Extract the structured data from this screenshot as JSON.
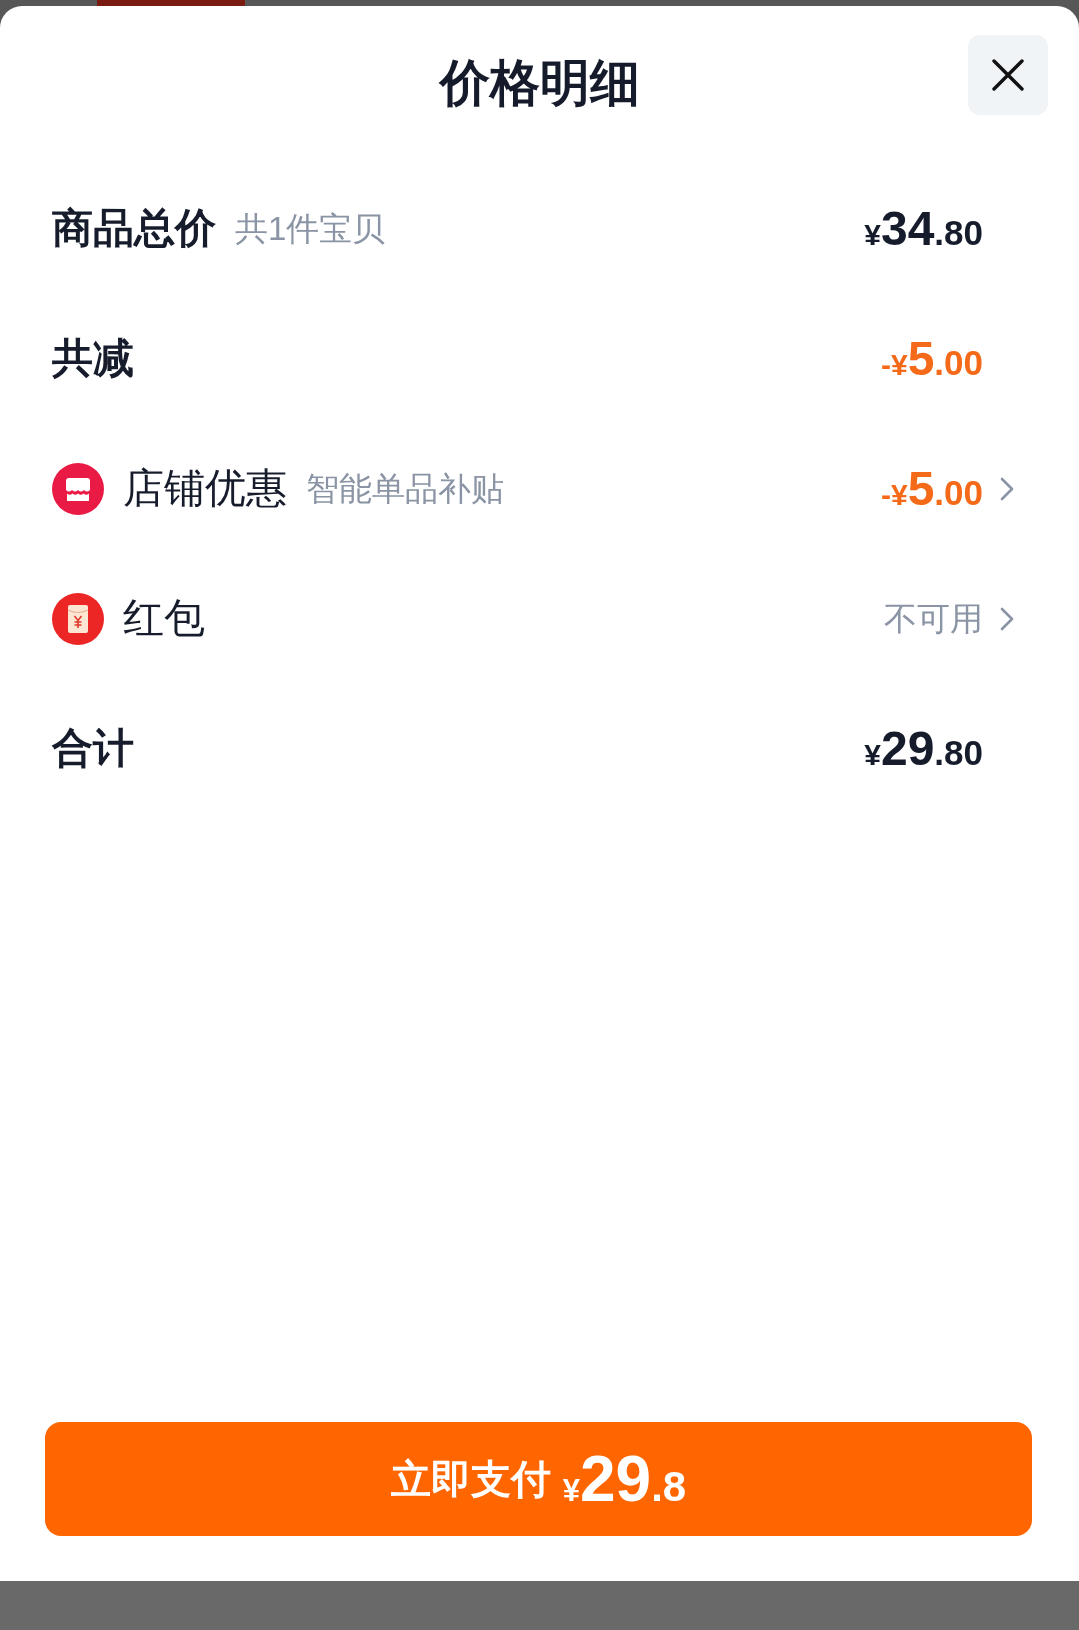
{
  "sheet": {
    "title": "价格明细"
  },
  "rows": [
    {
      "kind": "summary",
      "label": "商品总价",
      "note": "共1件宝贝",
      "value": {
        "kind": "price",
        "prefix": "¥",
        "integer": "34",
        "fraction": ".80"
      }
    },
    {
      "kind": "summary",
      "label": "共减",
      "value": {
        "kind": "discount",
        "prefix": "-¥",
        "integer": "5",
        "fraction": ".00"
      }
    },
    {
      "kind": "shop",
      "label": "店铺优惠",
      "note": "智能单品补贴",
      "value": {
        "kind": "discount",
        "prefix": "-¥",
        "integer": "5",
        "fraction": ".00"
      }
    },
    {
      "kind": "envelope",
      "label": "红包",
      "value": {
        "kind": "text",
        "text": "不可用"
      }
    },
    {
      "kind": "summary",
      "label": "合计",
      "value": {
        "kind": "price",
        "prefix": "¥",
        "integer": "29",
        "fraction": ".80"
      }
    }
  ],
  "pay_button": {
    "label": "立即支付",
    "prefix": "¥",
    "integer": "29",
    "fraction": ".8"
  }
}
